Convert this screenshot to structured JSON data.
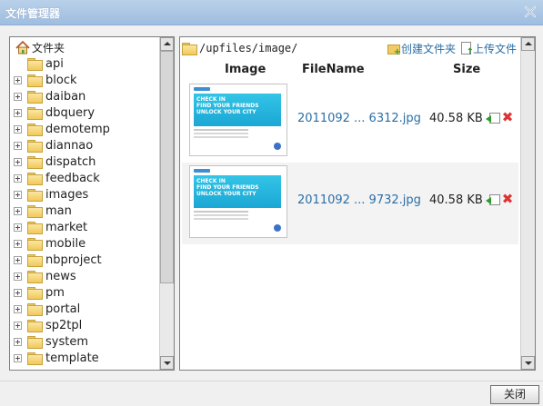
{
  "window": {
    "title": "文件管理器",
    "close_icon": "close-icon"
  },
  "tree": {
    "root_label": "文件夹",
    "root_icon": "home-icon",
    "items": [
      {
        "label": "api",
        "expandable": false
      },
      {
        "label": "block",
        "expandable": true
      },
      {
        "label": "daiban",
        "expandable": true
      },
      {
        "label": "dbquery",
        "expandable": true
      },
      {
        "label": "demotemp",
        "expandable": true
      },
      {
        "label": "diannao",
        "expandable": true
      },
      {
        "label": "dispatch",
        "expandable": true
      },
      {
        "label": "feedback",
        "expandable": true
      },
      {
        "label": "images",
        "expandable": true
      },
      {
        "label": "man",
        "expandable": true
      },
      {
        "label": "market",
        "expandable": true
      },
      {
        "label": "mobile",
        "expandable": true
      },
      {
        "label": "nbproject",
        "expandable": true
      },
      {
        "label": "news",
        "expandable": true
      },
      {
        "label": "pm",
        "expandable": true
      },
      {
        "label": "portal",
        "expandable": true
      },
      {
        "label": "sp2tpl",
        "expandable": true
      },
      {
        "label": "system",
        "expandable": true
      },
      {
        "label": "template",
        "expandable": true
      }
    ]
  },
  "file_panel": {
    "path": "/upfiles/image/",
    "new_folder_label": "创建文件夹",
    "upload_label": "上传文件",
    "columns": {
      "image": "Image",
      "filename": "FileName",
      "size": "Size"
    },
    "files": [
      {
        "name": "2011092 ... 6312.jpg",
        "size": "40.58 KB",
        "thumb_lines": [
          "CHECK IN",
          "FIND YOUR FRIENDS",
          "UNLOCK YOUR CITY"
        ]
      },
      {
        "name": "2011092 ... 9732.jpg",
        "size": "40.58 KB",
        "thumb_lines": [
          "CHECK IN",
          "FIND YOUR FRIENDS",
          "UNLOCK YOUR CITY"
        ]
      }
    ]
  },
  "footer": {
    "close_label": "关闭"
  },
  "colors": {
    "titlebar": "#b9d1ea",
    "link": "#2a6ea6",
    "delete": "#dd3333",
    "rename": "#2c9a2c"
  }
}
